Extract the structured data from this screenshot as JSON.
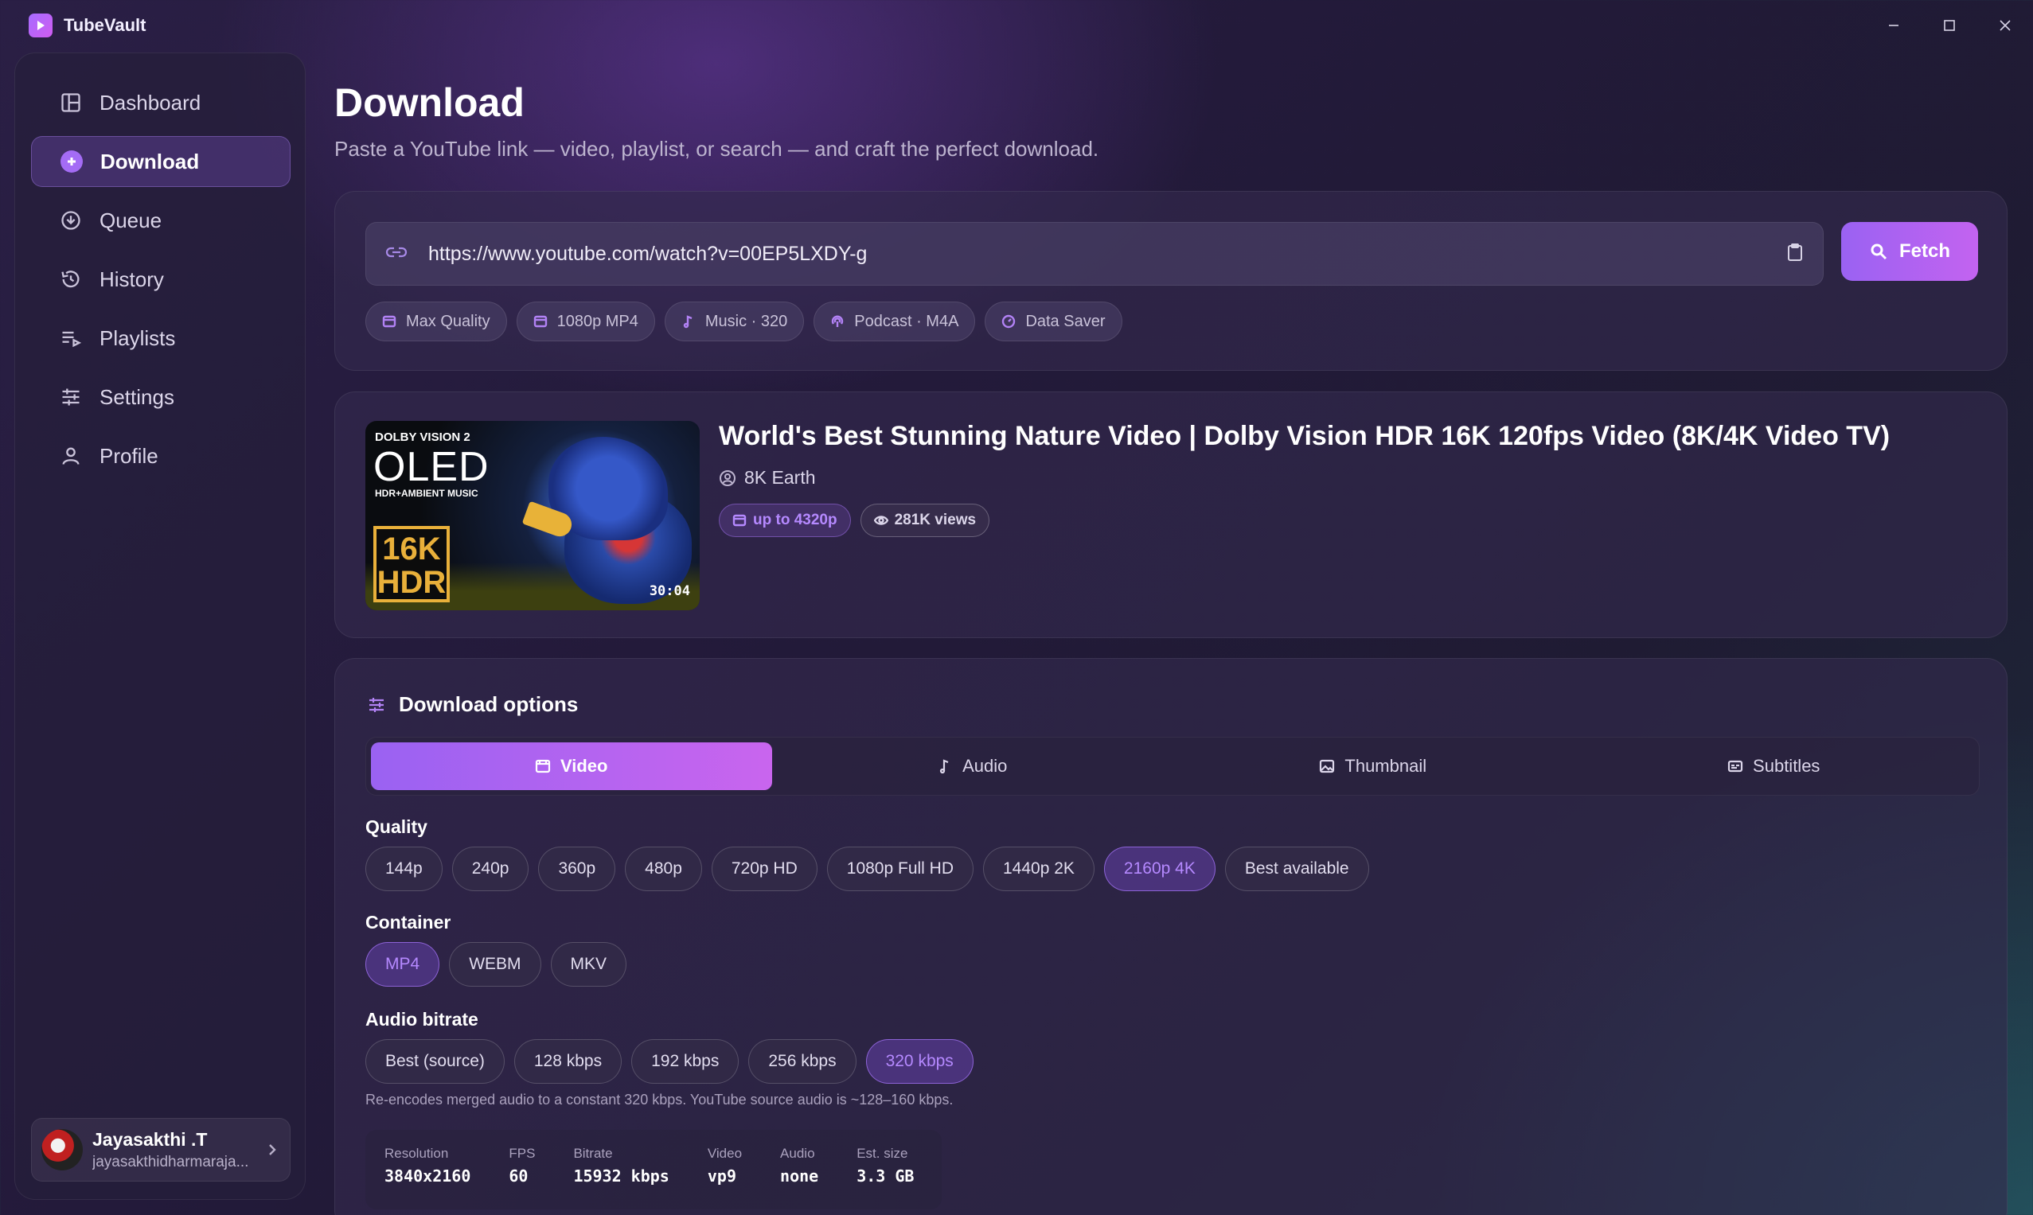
{
  "app": {
    "name": "TubeVault"
  },
  "sidebar": {
    "items": [
      {
        "label": "Dashboard",
        "icon": "dashboard-icon"
      },
      {
        "label": "Download",
        "icon": "plus-circle-icon",
        "active": true
      },
      {
        "label": "Queue",
        "icon": "queue-icon"
      },
      {
        "label": "History",
        "icon": "history-icon"
      },
      {
        "label": "Playlists",
        "icon": "playlist-icon"
      },
      {
        "label": "Settings",
        "icon": "sliders-icon"
      },
      {
        "label": "Profile",
        "icon": "user-icon"
      }
    ],
    "profile": {
      "name": "Jayasakthi .T",
      "email": "jayasakthidharmaraja..."
    }
  },
  "page": {
    "title": "Download",
    "subtitle": "Paste a YouTube link — video, playlist, or search — and craft the perfect download."
  },
  "url": {
    "value": "https://www.youtube.com/watch?v=00EP5LXDY-g",
    "fetch_label": "Fetch"
  },
  "presets": [
    "Max Quality",
    "1080p MP4",
    "Music · 320",
    "Podcast · M4A",
    "Data Saver"
  ],
  "video": {
    "title": "World's Best Stunning Nature Video | Dolby Vision HDR 16K 120fps Video (8K/4K Video TV)",
    "channel": "8K Earth",
    "max_quality": "up to 4320p",
    "views": "281K views",
    "duration": "30:04",
    "thumb_text": {
      "dolby": "DOLBY VISION 2",
      "oled": "OLED",
      "tagline": "HDR+AMBIENT MUSIC",
      "badge_top": "16K",
      "badge_bottom": "HDR"
    }
  },
  "options": {
    "heading": "Download options",
    "tabs": [
      "Video",
      "Audio",
      "Thumbnail",
      "Subtitles"
    ],
    "active_tab": "Video",
    "quality_label": "Quality",
    "quality": [
      "144p",
      "240p",
      "360p",
      "480p",
      "720p HD",
      "1080p Full HD",
      "1440p 2K",
      "2160p 4K",
      "Best available"
    ],
    "quality_selected": "2160p 4K",
    "container_label": "Container",
    "container": [
      "MP4",
      "WEBM",
      "MKV"
    ],
    "container_selected": "MP4",
    "bitrate_label": "Audio bitrate",
    "bitrate": [
      "Best (source)",
      "128 kbps",
      "192 kbps",
      "256 kbps",
      "320 kbps"
    ],
    "bitrate_selected": "320 kbps",
    "note": "Re-encodes merged audio to a constant 320 kbps. YouTube source audio is ~128–160 kbps."
  },
  "stats": [
    {
      "k": "Resolution",
      "v": "3840x2160"
    },
    {
      "k": "FPS",
      "v": "60"
    },
    {
      "k": "Bitrate",
      "v": "15932 kbps"
    },
    {
      "k": "Video",
      "v": "vp9"
    },
    {
      "k": "Audio",
      "v": "none"
    },
    {
      "k": "Est. size",
      "v": "3.3 GB"
    }
  ],
  "colors": {
    "accent": "#a46cf5",
    "accent2": "#c965ee",
    "bg": "#241b3c"
  }
}
